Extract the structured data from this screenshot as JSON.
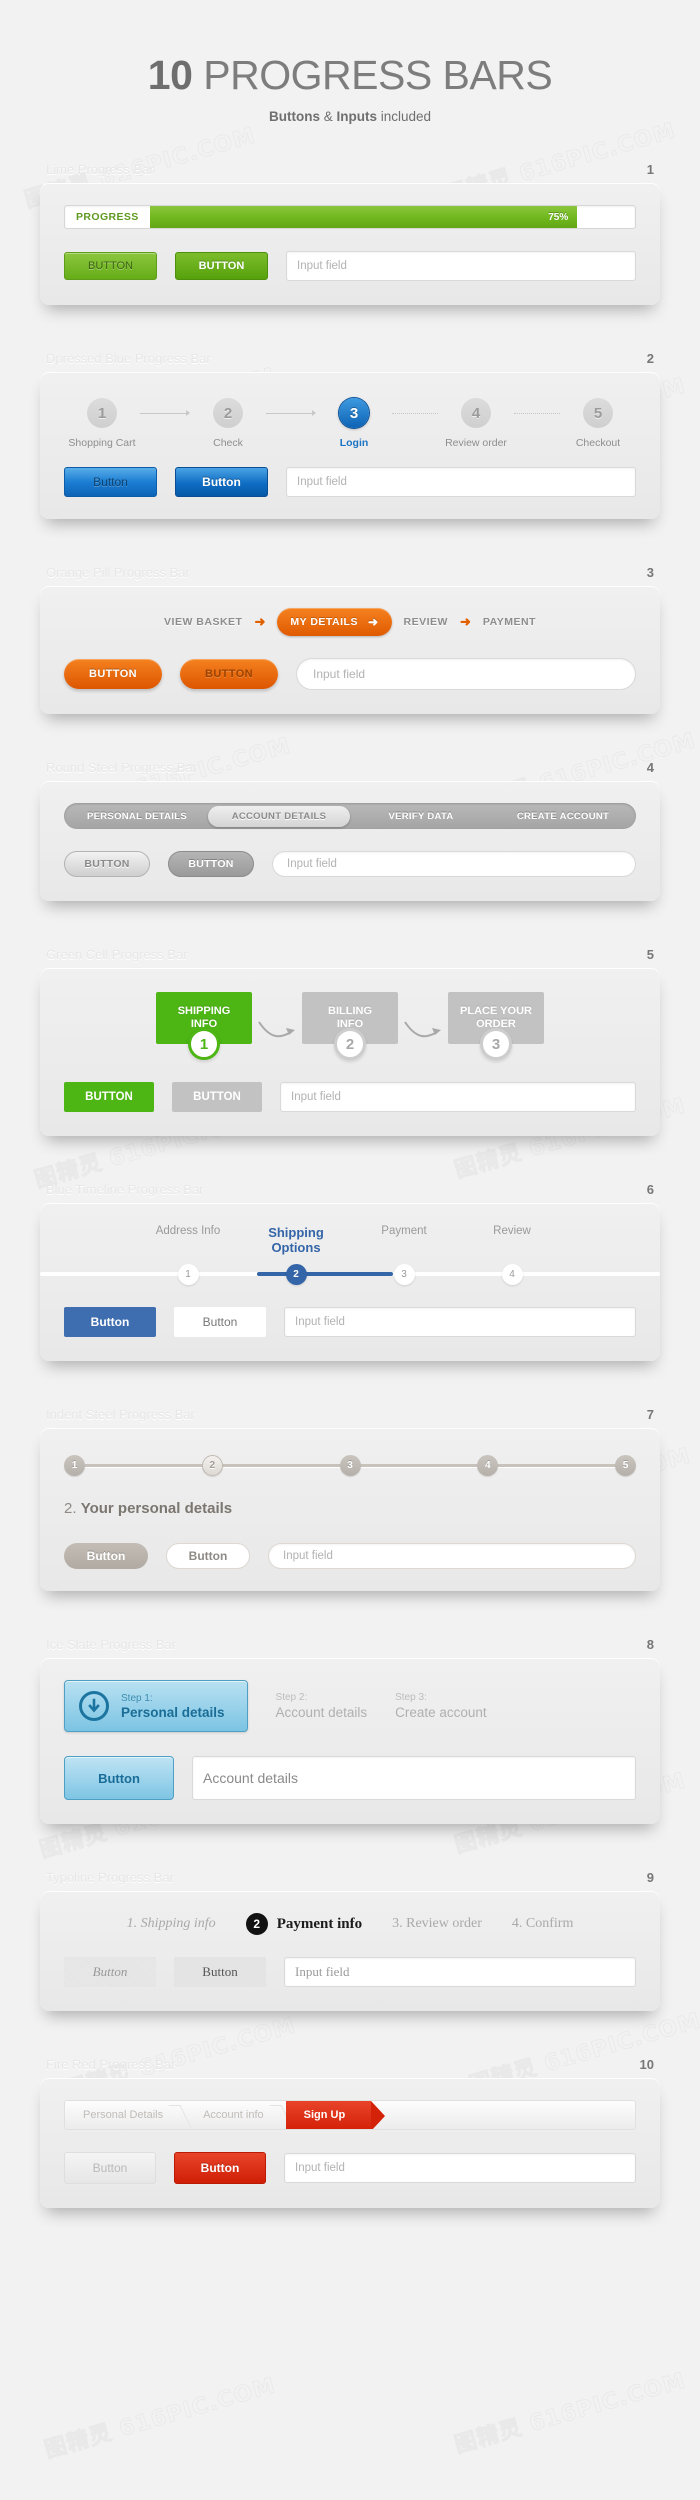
{
  "header": {
    "title_bold": "10",
    "title_rest": " PROGRESS BARS",
    "sub_a": "Buttons",
    "sub_b": " & ",
    "sub_c": "Inputs",
    "sub_d": " included"
  },
  "watermark": "图精灵 616PIC.COM",
  "common": {
    "input_placeholder": "Input field"
  },
  "sections": [
    {
      "num": "1",
      "label": "Lime Progress Bar",
      "bar_label": "PROGRESS",
      "percent": "75%",
      "percent_value": 75,
      "btn_a": "BUTTON",
      "btn_b": "BUTTON",
      "input_placeholder": "Input field"
    },
    {
      "num": "2",
      "label": "Dpressed Blue Progress Bar",
      "steps": [
        {
          "n": "1",
          "label": "Shopping Cart",
          "active": false
        },
        {
          "n": "2",
          "label": "Check",
          "active": false
        },
        {
          "n": "3",
          "label": "Login",
          "active": true
        },
        {
          "n": "4",
          "label": "Review order",
          "active": false
        },
        {
          "n": "5",
          "label": "Checkout",
          "active": false
        }
      ],
      "btn_a": "Button",
      "btn_b": "Button",
      "input_placeholder": "Input field"
    },
    {
      "num": "3",
      "label": "Orange Pill Progress Bar",
      "steps": [
        {
          "label": "VIEW BASKET",
          "active": false
        },
        {
          "label": "MY DETAILS",
          "active": true
        },
        {
          "label": "REVIEW",
          "active": false
        },
        {
          "label": "PAYMENT",
          "active": false
        }
      ],
      "btn_a": "BUTTON",
      "btn_b": "BUTTON",
      "input_placeholder": "Input field"
    },
    {
      "num": "4",
      "label": "Round Steel Progress Bar",
      "steps": [
        {
          "label": "PERSONAL DETAILS",
          "active": false
        },
        {
          "label": "ACCOUNT DETAILS",
          "active": true
        },
        {
          "label": "VERIFY DATA",
          "active": false
        },
        {
          "label": "CREATE ACCOUNT",
          "active": false
        }
      ],
      "btn_a": "BUTTON",
      "btn_b": "BUTTON",
      "input_placeholder": "Input field"
    },
    {
      "num": "5",
      "label": "Green Cell Progress Bar",
      "steps": [
        {
          "line1": "SHIPPING",
          "line2": "INFO",
          "n": "1",
          "active": true
        },
        {
          "line1": "BILLING",
          "line2": "INFO",
          "n": "2",
          "active": false
        },
        {
          "line1": "PLACE YOUR",
          "line2": "ORDER",
          "n": "3",
          "active": false
        }
      ],
      "btn_a": "BUTTON",
      "btn_b": "BUTTON",
      "input_placeholder": "Input field"
    },
    {
      "num": "6",
      "label": "Blue Timeline Progress Bar",
      "steps": [
        {
          "n": "1",
          "label": "Address Info",
          "active": false
        },
        {
          "n": "2",
          "label": "Shipping Options",
          "active": true
        },
        {
          "n": "3",
          "label": "Payment",
          "active": false
        },
        {
          "n": "4",
          "label": "Review",
          "active": false
        }
      ],
      "btn_a": "Button",
      "btn_b": "Button",
      "input_placeholder": "Input field"
    },
    {
      "num": "7",
      "label": "Indent Steel Progress Bar",
      "steps": [
        {
          "n": "1",
          "active": false
        },
        {
          "n": "2",
          "active": true
        },
        {
          "n": "3",
          "active": false
        },
        {
          "n": "4",
          "active": false
        },
        {
          "n": "5",
          "active": false
        }
      ],
      "heading_num": "2. ",
      "heading_text": "Your personal details",
      "btn_a": "Button",
      "btn_b": "Button",
      "input_placeholder": "Input field"
    },
    {
      "num": "8",
      "label": "Ice Slate Progress Bar",
      "steps": [
        {
          "top": "Step 1:",
          "bottom": "Personal details",
          "active": true,
          "icon": "arrow-down-circle-icon"
        },
        {
          "top": "Step 2:",
          "bottom": "Account details",
          "active": false
        },
        {
          "top": "Step 3:",
          "bottom": "Create account",
          "active": false
        }
      ],
      "btn_a": "Button",
      "input_placeholder": "Account details"
    },
    {
      "num": "9",
      "label": "Typoline Progress Bar",
      "steps": [
        {
          "label": "1. Shipping info",
          "active": false,
          "italic": true
        },
        {
          "n": "2",
          "label": "Payment info",
          "active": true
        },
        {
          "label": "3. Review order",
          "active": false,
          "italic": false
        },
        {
          "label": "4. Confirm",
          "active": false,
          "italic": false
        }
      ],
      "btn_a": "Button",
      "btn_b": "Button",
      "input_placeholder": "Input field"
    },
    {
      "num": "10",
      "label": "Fire Red Progress Bar",
      "steps": [
        {
          "label": "Personal Details",
          "active": false
        },
        {
          "label": "Account info",
          "active": false
        },
        {
          "label": "Sign Up",
          "active": true
        }
      ],
      "btn_a": "Button",
      "btn_b": "Button",
      "input_placeholder": "Input field"
    }
  ],
  "colors": {
    "lime": "#6eb71c",
    "blue": "#0d63b5",
    "orange": "#e05a00",
    "steel": "#a4a4a4",
    "green": "#4db514",
    "timeline_blue": "#3465a8",
    "indent": "#b5b0a9",
    "ice": "#1a6d97",
    "typo": "#121212",
    "red": "#d42208"
  }
}
